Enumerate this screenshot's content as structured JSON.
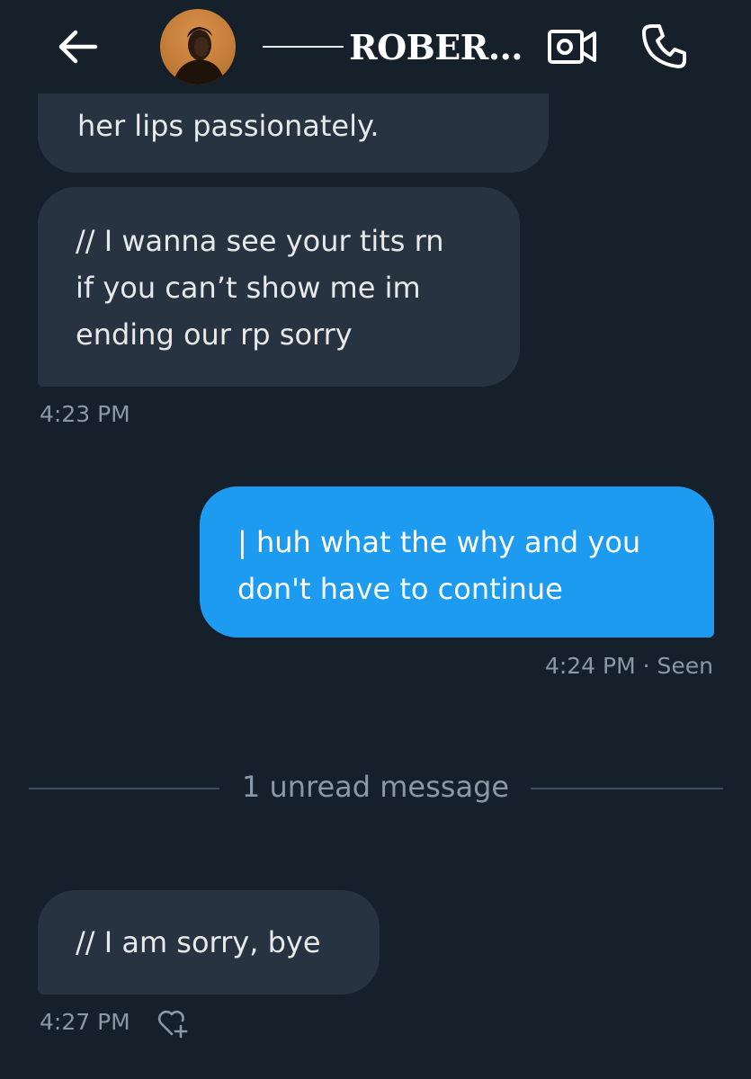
{
  "header": {
    "contact_name": "ROBER...",
    "back_icon": "arrow-left-icon",
    "video_icon": "video-camera-icon",
    "call_icon": "phone-icon"
  },
  "messages": [
    {
      "direction": "received",
      "lines": [
        "her lips passionately."
      ]
    },
    {
      "direction": "received",
      "lines": [
        "// I wanna see your tits rn",
        "if you can’t show me im",
        "ending our rp sorry"
      ],
      "timestamp": "4:23 PM"
    },
    {
      "direction": "sent",
      "lines": [
        "| huh what the why and you",
        "don't have to continue"
      ],
      "timestamp": "4:24 PM · Seen"
    },
    {
      "direction": "received",
      "lines": [
        "// I am sorry, bye"
      ],
      "timestamp": "4:27 PM"
    }
  ],
  "unread_divider": {
    "label": "1 unread message"
  },
  "colors": {
    "background": "#15202b",
    "received_bubble": "#273340",
    "sent_bubble": "#1d9bf0",
    "meta_text": "#8b98a5"
  }
}
